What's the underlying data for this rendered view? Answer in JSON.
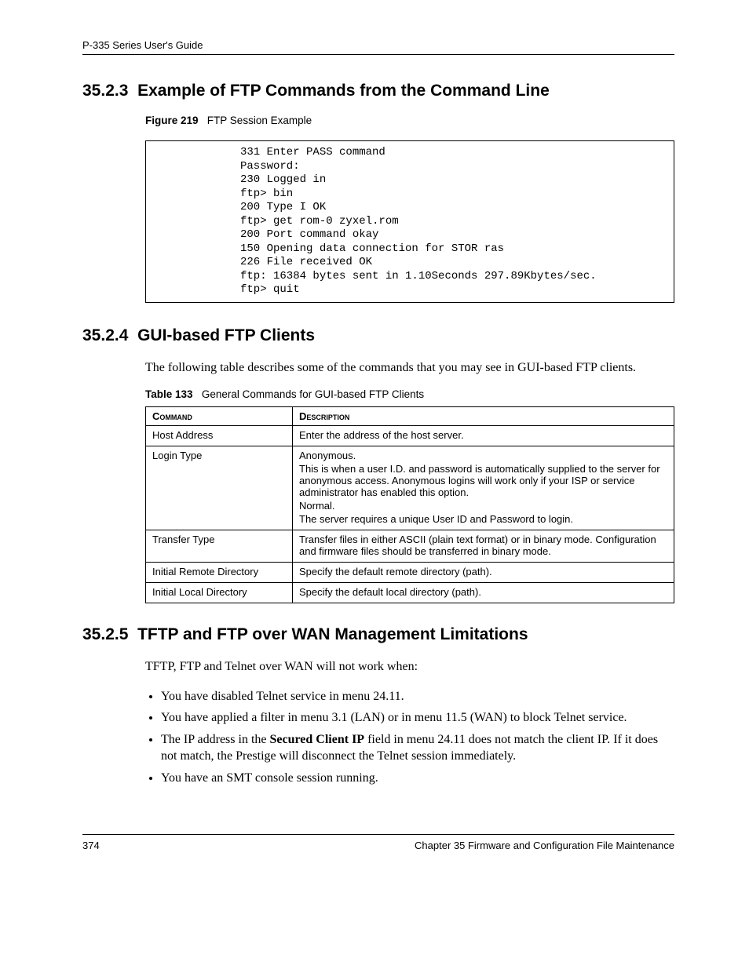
{
  "header": {
    "title": "P-335 Series User's Guide"
  },
  "sections": {
    "s1": {
      "num": "35.2.3",
      "title": "Example of FTP Commands from the Command Line"
    },
    "s2": {
      "num": "35.2.4",
      "title": "GUI-based FTP Clients"
    },
    "s3": {
      "num": "35.2.5",
      "title": "TFTP and FTP over WAN Management Limitations"
    }
  },
  "figure": {
    "label": "Figure 219",
    "caption": "FTP Session Example"
  },
  "code": "331 Enter PASS command\nPassword:\n230 Logged in\nftp> bin\n200 Type I OK\nftp> get rom-0 zyxel.rom\n200 Port command okay\n150 Opening data connection for STOR ras\n226 File received OK\nftp: 16384 bytes sent in 1.10Seconds 297.89Kbytes/sec.\nftp> quit",
  "para": {
    "p1": "The following table describes some of the commands that you may see in GUI-based FTP clients.",
    "p2": "TFTP, FTP and Telnet over WAN will not work when:"
  },
  "table": {
    "label": "Table 133",
    "caption": "General Commands for GUI-based FTP Clients",
    "head": {
      "c1": "Command",
      "c2": "Description"
    },
    "rows": [
      {
        "cmd": "Host Address",
        "desc": [
          "Enter the address of the host server."
        ]
      },
      {
        "cmd": "Login Type",
        "desc": [
          "Anonymous.",
          "This is when a user I.D. and password is automatically supplied to the server for anonymous access.  Anonymous logins will work only if your ISP or service administrator has enabled this option.",
          "Normal.",
          "The server requires a unique User ID and Password to login."
        ]
      },
      {
        "cmd": "Transfer Type",
        "desc": [
          "Transfer files in either ASCII (plain text format) or in binary mode. Configuration and firmware files should be transferred in binary mode."
        ]
      },
      {
        "cmd": "Initial Remote Directory",
        "desc": [
          "Specify the default remote directory (path)."
        ]
      },
      {
        "cmd": "Initial Local Directory",
        "desc": [
          "Specify the default local directory (path)."
        ]
      }
    ]
  },
  "bullets": {
    "b1": "You have disabled Telnet service in menu 24.11.",
    "b2": "You have applied a filter in menu 3.1 (LAN) or in menu 11.5 (WAN) to block Telnet service.",
    "b3a": "The IP address in the ",
    "b3b": "Secured Client IP",
    "b3c": " field in menu 24.11 does not match the client IP. If it does not match, the Prestige will disconnect the Telnet session immediately.",
    "b4": "You have an SMT console session running."
  },
  "footer": {
    "page": "374",
    "chapter": "Chapter 35 Firmware and Configuration File Maintenance"
  }
}
